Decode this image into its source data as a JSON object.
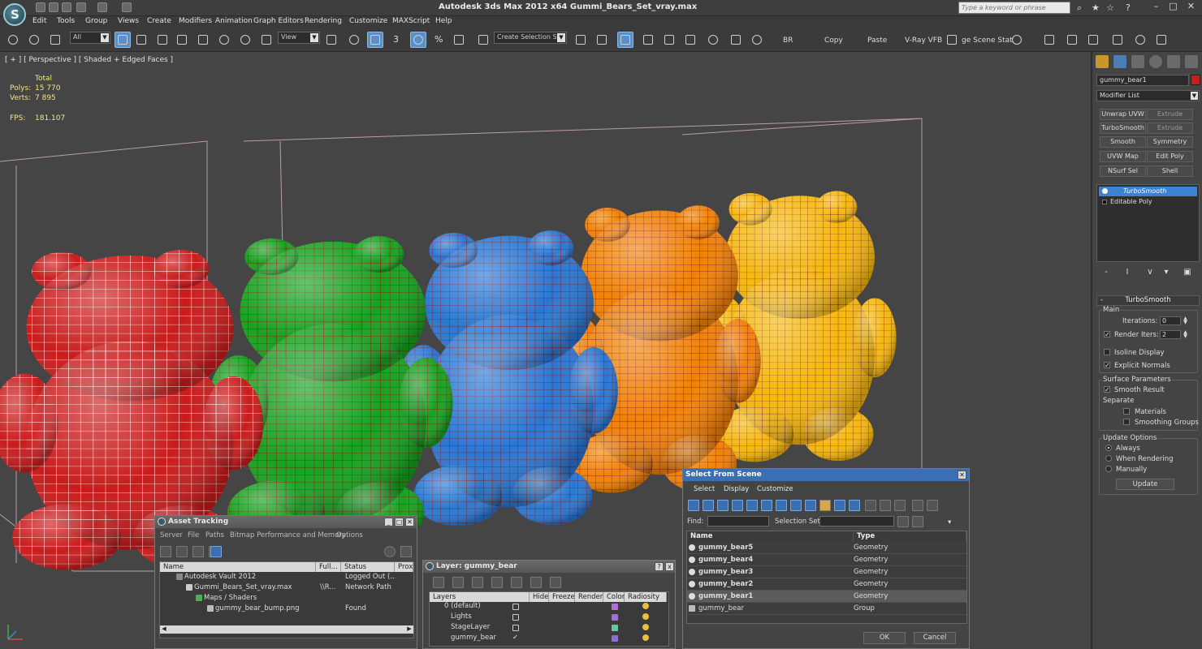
{
  "app": {
    "title": "Autodesk 3ds Max  2012 x64     Gummi_Bears_Set_vray.max",
    "logo_letter": "S",
    "search_placeholder": "Type a keyword or phrase"
  },
  "menu": [
    "Edit",
    "Tools",
    "Group",
    "Views",
    "Create",
    "Modifiers",
    "Animation",
    "Graph Editors",
    "Rendering",
    "Customize",
    "MAXScript",
    "Help"
  ],
  "toolbar": {
    "filter_value": "All",
    "ref_coord_value": "View",
    "snap_label": "3",
    "percent_label": "%",
    "selection_set_placeholder": "Create Selection Se",
    "br_label": "BR",
    "copy_label": "Copy",
    "paste_label": "Paste",
    "vray_vfb_label": "V-Ray VFB",
    "scene_states_label": "ge Scene Stat"
  },
  "viewport": {
    "label": "[ + ] [ Perspective ] [ Shaded + Edged Faces ]",
    "stats": {
      "total_label": "Total",
      "polys_label": "Polys:",
      "polys_value": "15 770",
      "verts_label": "Verts:",
      "verts_value": "7 895",
      "fps_label": "FPS:",
      "fps_value": "181.107"
    },
    "bear_colors": [
      "#c91b1b",
      "#17a21f",
      "#2a77d4",
      "#f08208",
      "#f4b90f"
    ]
  },
  "command_panel": {
    "object_name": "gummy_bear1",
    "object_color": "#c81e1e",
    "modifier_list_label": "Modifier List",
    "modifier_buttons": [
      "Unwrap UVW",
      "Extrude",
      "TurboSmooth",
      "Extrude",
      "Smooth",
      "Symmetry",
      "UVW Map",
      "Edit Poly",
      "NSurf Sel",
      "Shell"
    ],
    "stack": [
      "TurboSmooth",
      "Editable Poly"
    ],
    "rollout_title": "TurboSmooth",
    "main_group": "Main",
    "iterations_label": "Iterations:",
    "iterations_value": "0",
    "render_iters_label": "Render Iters:",
    "render_iters_value": "2",
    "isoline_label": "Isoline Display",
    "explicit_normals_label": "Explicit Normals",
    "surface_params_label": "Surface Parameters",
    "smooth_result_label": "Smooth Result",
    "separate_label": "Separate",
    "materials_label": "Materials",
    "smoothing_groups_label": "Smoothing Groups",
    "update_options_label": "Update Options",
    "always_label": "Always",
    "when_rendering_label": "When Rendering",
    "manually_label": "Manually",
    "update_button": "Update"
  },
  "asset_tracking": {
    "title": "Asset Tracking",
    "menu": [
      "Server",
      "File",
      "Paths",
      "Bitmap Performance and Memory",
      "Options"
    ],
    "columns": [
      "Name",
      "Full...",
      "Status",
      "Prox"
    ],
    "rows": [
      {
        "name": "Autodesk Vault 2012",
        "full": "",
        "status": "Logged Out (..."
      },
      {
        "name": "Gummi_Bears_Set_vray.max",
        "full": "\\\\R...",
        "status": "Network Path"
      },
      {
        "name": "Maps / Shaders",
        "full": "",
        "status": ""
      },
      {
        "name": "gummy_bear_bump.png",
        "full": "",
        "status": "Found"
      }
    ]
  },
  "layer_window": {
    "title": "Layer: gummy_bear",
    "close": "x",
    "help": "?",
    "columns": [
      "Layers",
      "Hide",
      "Freeze",
      "Render",
      "Color",
      "Radiosity"
    ],
    "layers": [
      {
        "name": "0 (default)",
        "color": "#b070d8"
      },
      {
        "name": "Lights",
        "color": "#a46fd4"
      },
      {
        "name": "StageLayer",
        "color": "#66c89a"
      },
      {
        "name": "gummy_bear",
        "color": "#8c6fd4"
      }
    ],
    "active_mark": "✓"
  },
  "select_from_scene": {
    "title": "Select From Scene",
    "menu": [
      "Select",
      "Display",
      "Customize"
    ],
    "find_label": "Find:",
    "selection_set_label": "Selection Set:",
    "col_name": "Name",
    "col_type": "Type",
    "rows": [
      {
        "name": "gummy_bear5",
        "type": "Geometry"
      },
      {
        "name": "gummy_bear4",
        "type": "Geometry"
      },
      {
        "name": "gummy_bear3",
        "type": "Geometry"
      },
      {
        "name": "gummy_bear2",
        "type": "Geometry"
      },
      {
        "name": "gummy_bear1",
        "type": "Geometry"
      },
      {
        "name": "gummy_bear",
        "type": "Group"
      }
    ],
    "ok_button": "OK",
    "cancel_button": "Cancel"
  }
}
